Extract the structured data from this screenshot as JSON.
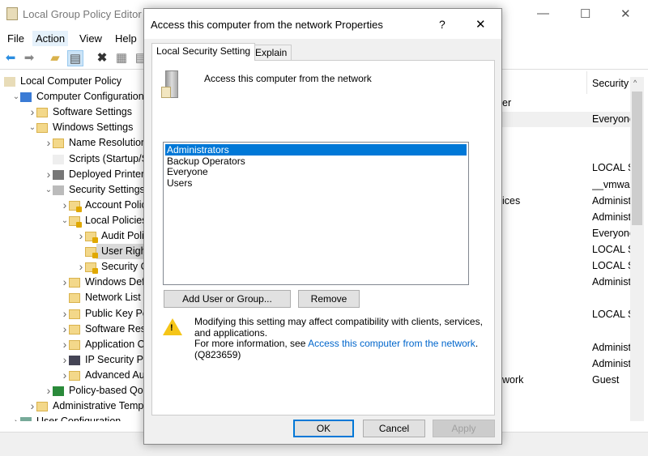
{
  "window": {
    "title": "Local Group Policy Editor",
    "minimize": "—",
    "maximize": "☐",
    "close": "✕"
  },
  "menu": [
    "File",
    "Action",
    "View",
    "Help"
  ],
  "toolbar": [
    "back-icon",
    "forward-icon",
    "up-folder-icon",
    "show-hide-tree-icon",
    "delete-icon",
    "properties-icon",
    "export-list-icon"
  ],
  "tree": [
    {
      "label": "Local Computer Policy",
      "level": 0,
      "chev": "",
      "icon": "policy"
    },
    {
      "label": "Computer Configuration",
      "level": 1,
      "chev": "down",
      "icon": "computer"
    },
    {
      "label": "Software Settings",
      "level": 2,
      "chev": "right",
      "icon": "folder"
    },
    {
      "label": "Windows Settings",
      "level": 2,
      "chev": "down",
      "icon": "folder"
    },
    {
      "label": "Name Resolution Policy",
      "level": 3,
      "chev": "right",
      "icon": "folder"
    },
    {
      "label": "Scripts (Startup/Shutdown)",
      "level": 3,
      "chev": "",
      "icon": "script"
    },
    {
      "label": "Deployed Printers",
      "level": 3,
      "chev": "right",
      "icon": "printer"
    },
    {
      "label": "Security Settings",
      "level": 3,
      "chev": "down",
      "icon": "security"
    },
    {
      "label": "Account Policies",
      "level": 4,
      "chev": "right",
      "icon": "lockfolder"
    },
    {
      "label": "Local Policies",
      "level": 4,
      "chev": "down",
      "icon": "lockfolder"
    },
    {
      "label": "Audit Policy",
      "level": 5,
      "chev": "right",
      "icon": "lockfolder"
    },
    {
      "label": "User Rights Assignment",
      "level": 5,
      "chev": "",
      "icon": "lockfolder",
      "selected": true
    },
    {
      "label": "Security Options",
      "level": 5,
      "chev": "right",
      "icon": "lockfolder"
    },
    {
      "label": "Windows Defender Firewall",
      "level": 4,
      "chev": "right",
      "icon": "folder"
    },
    {
      "label": "Network List Manager Policies",
      "level": 4,
      "chev": "",
      "icon": "folder"
    },
    {
      "label": "Public Key Policies",
      "level": 4,
      "chev": "right",
      "icon": "folder"
    },
    {
      "label": "Software Restriction Policies",
      "level": 4,
      "chev": "right",
      "icon": "folder"
    },
    {
      "label": "Application Control Policies",
      "level": 4,
      "chev": "right",
      "icon": "folder"
    },
    {
      "label": "IP Security Policies",
      "level": 4,
      "chev": "right",
      "icon": "ipsec"
    },
    {
      "label": "Advanced Audit Policy Configuration",
      "level": 4,
      "chev": "right",
      "icon": "folder"
    },
    {
      "label": "Policy-based QoS",
      "level": 3,
      "chev": "right",
      "icon": "chart"
    },
    {
      "label": "Administrative Templates",
      "level": 2,
      "chev": "right",
      "icon": "folder"
    },
    {
      "label": "User Configuration",
      "level": 1,
      "chev": "right",
      "icon": "user"
    }
  ],
  "details": {
    "column_header": "Security Setting",
    "rows": [
      {
        "policy": "er",
        "setting": ""
      },
      {
        "policy": "",
        "setting": "Everyone"
      },
      {
        "policy": "",
        "setting": ""
      },
      {
        "policy": "",
        "setting": ""
      },
      {
        "policy": "",
        "setting": "LOCAL SERVICE"
      },
      {
        "policy": "",
        "setting": "__vmware"
      },
      {
        "policy": "ices",
        "setting": "Administrators"
      },
      {
        "policy": "",
        "setting": "Administrators"
      },
      {
        "policy": "",
        "setting": "Everyone"
      },
      {
        "policy": "",
        "setting": "LOCAL SERVICE"
      },
      {
        "policy": "",
        "setting": "LOCAL SERVICE"
      },
      {
        "policy": "",
        "setting": "Administrators"
      },
      {
        "policy": "",
        "setting": ""
      },
      {
        "policy": "",
        "setting": "LOCAL SERVICE"
      },
      {
        "policy": "",
        "setting": ""
      },
      {
        "policy": "",
        "setting": "Administrators"
      },
      {
        "policy": "",
        "setting": "Administrators"
      },
      {
        "policy": "work",
        "setting": "Guest"
      }
    ]
  },
  "dialog": {
    "title": "Access this computer from the network Properties",
    "help": "?",
    "close": "✕",
    "tabs": [
      "Local Security Setting",
      "Explain"
    ],
    "heading": "Access this computer from the network",
    "members": [
      "Administrators",
      "Backup Operators",
      "Everyone",
      "Users"
    ],
    "selected_member": "Administrators",
    "add_button": "Add User or Group...",
    "remove_button": "Remove",
    "warning_line1": "Modifying this setting may affect compatibility with clients, services,",
    "warning_line2": "and applications.",
    "info_prefix": "For more information, see ",
    "info_link": "Access this computer from the network",
    "info_suffix": ".",
    "kb": "(Q823659)",
    "ok": "OK",
    "cancel": "Cancel",
    "apply": "Apply"
  }
}
